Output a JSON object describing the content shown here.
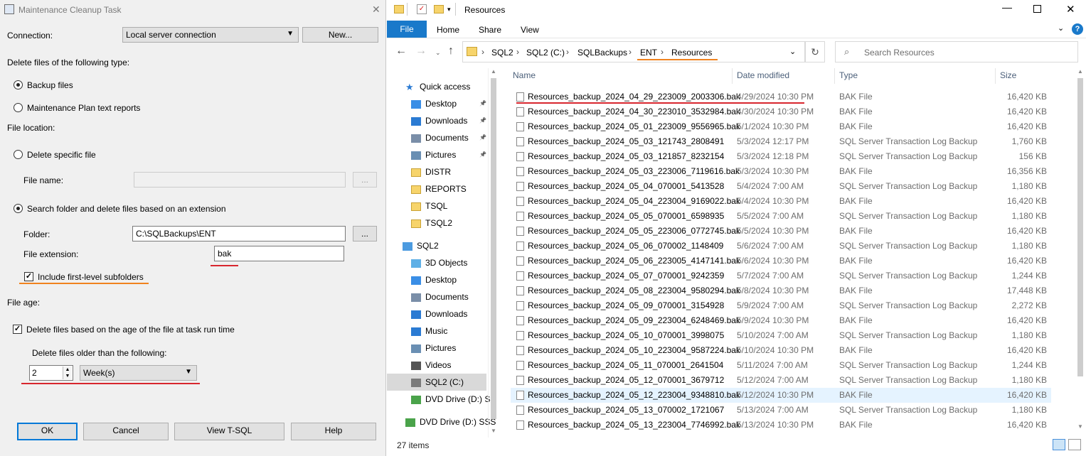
{
  "dialog": {
    "title": "Maintenance Cleanup Task",
    "close_glyph": "✕",
    "connection_label": "Connection:",
    "connection_value": "Local server connection",
    "new_button": "New...",
    "delete_type_label": "Delete files of the following type:",
    "backup_files": "Backup files",
    "maintenance_reports": "Maintenance Plan text reports",
    "file_location": "File location:",
    "delete_specific": "Delete specific file",
    "file_name_label": "File name:",
    "file_name_value": "",
    "browse": "...",
    "search_folder": "Search folder and delete files based on an extension",
    "folder_label": "Folder:",
    "folder_value": "C:\\SQLBackups\\ENT",
    "ext_label": "File extension:",
    "ext_value": "bak",
    "include_subfolders": "Include first-level subfolders",
    "file_age": "File age:",
    "delete_age": "Delete files based on the age of the file at task run time",
    "older_than": "Delete files older than the following:",
    "age_value": "2",
    "age_unit": "Week(s)",
    "ok": "OK",
    "cancel": "Cancel",
    "view_tsql": "View T-SQL",
    "help": "Help"
  },
  "explorer": {
    "title": "Resources",
    "tabs": [
      "File",
      "Home",
      "Share",
      "View"
    ],
    "breadcrumb": [
      "SQL2",
      "SQL2 (C:)",
      "SQLBackups",
      "ENT",
      "Resources"
    ],
    "search_placeholder": "Search Resources",
    "nav": [
      {
        "label": "Quick access",
        "icon": "star-icon"
      },
      {
        "label": "Desktop",
        "icon": "desktop-icon",
        "pin": true
      },
      {
        "label": "Downloads",
        "icon": "download-icon",
        "pin": true
      },
      {
        "label": "Documents",
        "icon": "documents-icon",
        "pin": true
      },
      {
        "label": "Pictures",
        "icon": "pictures-icon",
        "pin": true
      },
      {
        "label": "DISTR",
        "icon": "folder-icon"
      },
      {
        "label": "REPORTS",
        "icon": "folder-icon"
      },
      {
        "label": "TSQL",
        "icon": "folder-icon"
      },
      {
        "label": "TSQL2",
        "icon": "folder-icon"
      },
      {
        "label": "SQL2",
        "icon": "computer-icon"
      },
      {
        "label": "3D Objects",
        "icon": "cube-icon"
      },
      {
        "label": "Desktop",
        "icon": "desktop-icon"
      },
      {
        "label": "Documents",
        "icon": "documents-icon"
      },
      {
        "label": "Downloads",
        "icon": "download-icon"
      },
      {
        "label": "Music",
        "icon": "music-icon"
      },
      {
        "label": "Pictures",
        "icon": "pictures-icon"
      },
      {
        "label": "Videos",
        "icon": "video-icon"
      },
      {
        "label": "SQL2 (C:)",
        "icon": "drive-icon"
      },
      {
        "label": "DVD Drive (D:) SS",
        "icon": "dvd-icon"
      },
      {
        "label": "DVD Drive (D:) SSS",
        "icon": "dvd-icon"
      }
    ],
    "columns": [
      "Name",
      "Date modified",
      "Type",
      "Size"
    ],
    "files": [
      [
        "Resources_backup_2024_04_29_223009_2003306.bak",
        "4/29/2024 10:30 PM",
        "BAK File",
        "16,420 KB"
      ],
      [
        "Resources_backup_2024_04_30_223010_3532984.bak",
        "4/30/2024 10:30 PM",
        "BAK File",
        "16,420 KB"
      ],
      [
        "Resources_backup_2024_05_01_223009_9556965.bak",
        "5/1/2024 10:30 PM",
        "BAK File",
        "16,420 KB"
      ],
      [
        "Resources_backup_2024_05_03_121743_2808491",
        "5/3/2024 12:17 PM",
        "SQL Server Transaction Log Backup",
        "1,760 KB"
      ],
      [
        "Resources_backup_2024_05_03_121857_8232154",
        "5/3/2024 12:18 PM",
        "SQL Server Transaction Log Backup",
        "156 KB"
      ],
      [
        "Resources_backup_2024_05_03_223006_7119616.bak",
        "5/3/2024 10:30 PM",
        "BAK File",
        "16,356 KB"
      ],
      [
        "Resources_backup_2024_05_04_070001_5413528",
        "5/4/2024 7:00 AM",
        "SQL Server Transaction Log Backup",
        "1,180 KB"
      ],
      [
        "Resources_backup_2024_05_04_223004_9169022.bak",
        "5/4/2024 10:30 PM",
        "BAK File",
        "16,420 KB"
      ],
      [
        "Resources_backup_2024_05_05_070001_6598935",
        "5/5/2024 7:00 AM",
        "SQL Server Transaction Log Backup",
        "1,180 KB"
      ],
      [
        "Resources_backup_2024_05_05_223006_0772745.bak",
        "5/5/2024 10:30 PM",
        "BAK File",
        "16,420 KB"
      ],
      [
        "Resources_backup_2024_05_06_070002_1148409",
        "5/6/2024 7:00 AM",
        "SQL Server Transaction Log Backup",
        "1,180 KB"
      ],
      [
        "Resources_backup_2024_05_06_223005_4147141.bak",
        "5/6/2024 10:30 PM",
        "BAK File",
        "16,420 KB"
      ],
      [
        "Resources_backup_2024_05_07_070001_9242359",
        "5/7/2024 7:00 AM",
        "SQL Server Transaction Log Backup",
        "1,244 KB"
      ],
      [
        "Resources_backup_2024_05_08_223004_9580294.bak",
        "5/8/2024 10:30 PM",
        "BAK File",
        "17,448 KB"
      ],
      [
        "Resources_backup_2024_05_09_070001_3154928",
        "5/9/2024 7:00 AM",
        "SQL Server Transaction Log Backup",
        "2,272 KB"
      ],
      [
        "Resources_backup_2024_05_09_223004_6248469.bak",
        "5/9/2024 10:30 PM",
        "BAK File",
        "16,420 KB"
      ],
      [
        "Resources_backup_2024_05_10_070001_3998075",
        "5/10/2024 7:00 AM",
        "SQL Server Transaction Log Backup",
        "1,180 KB"
      ],
      [
        "Resources_backup_2024_05_10_223004_9587224.bak",
        "5/10/2024 10:30 PM",
        "BAK File",
        "16,420 KB"
      ],
      [
        "Resources_backup_2024_05_11_070001_2641504",
        "5/11/2024 7:00 AM",
        "SQL Server Transaction Log Backup",
        "1,244 KB"
      ],
      [
        "Resources_backup_2024_05_12_070001_3679712",
        "5/12/2024 7:00 AM",
        "SQL Server Transaction Log Backup",
        "1,180 KB"
      ],
      [
        "Resources_backup_2024_05_12_223004_9348810.bak",
        "5/12/2024 10:30 PM",
        "BAK File",
        "16,420 KB"
      ],
      [
        "Resources_backup_2024_05_13_070002_1721067",
        "5/13/2024 7:00 AM",
        "SQL Server Transaction Log Backup",
        "1,180 KB"
      ],
      [
        "Resources_backup_2024_05_13_223004_7746992.bak",
        "5/13/2024 10:30 PM",
        "BAK File",
        "16,420 KB"
      ]
    ],
    "status": "27 items",
    "colors": {
      "accent": "#0078d7",
      "red_underline": "#d8262e",
      "orange_underline": "#f0821e"
    }
  }
}
